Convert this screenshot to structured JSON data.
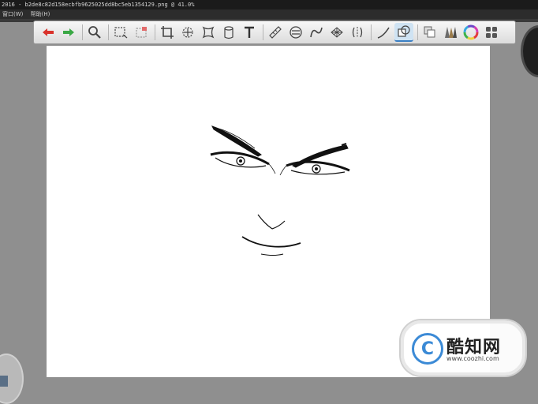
{
  "titlebar": {
    "text": "2016 - b2de8c82d158ecbfb9625025dd8bc5eb1354129.png @ 41.0%"
  },
  "menu": {
    "items": [
      "窗口(W)",
      "帮助(H)"
    ]
  },
  "toolbar": {
    "tools": [
      "undo-icon",
      "redo-icon",
      "zoom-icon",
      "select-rect-icon",
      "deselect-icon",
      "crop-icon",
      "transform-icon",
      "warp-icon",
      "bucket-icon",
      "text-icon",
      "ruler-icon",
      "symmetry-icon",
      "curve-ruler-icon",
      "perspective-icon",
      "mirror-icon",
      "pen-icon",
      "layer-shape-icon",
      "copy-icon",
      "brush-set-icon",
      "color-wheel-icon",
      "panels-icon"
    ],
    "active": "layer-shape-icon"
  },
  "watermark": {
    "name": "酷知网",
    "url": "www.coozhi.com",
    "logo_color": "#3b8ad6"
  },
  "colors": {
    "workspace": "#8f8f8f",
    "canvas": "#ffffff",
    "undo": "#d9322b",
    "redo": "#3aa845"
  }
}
